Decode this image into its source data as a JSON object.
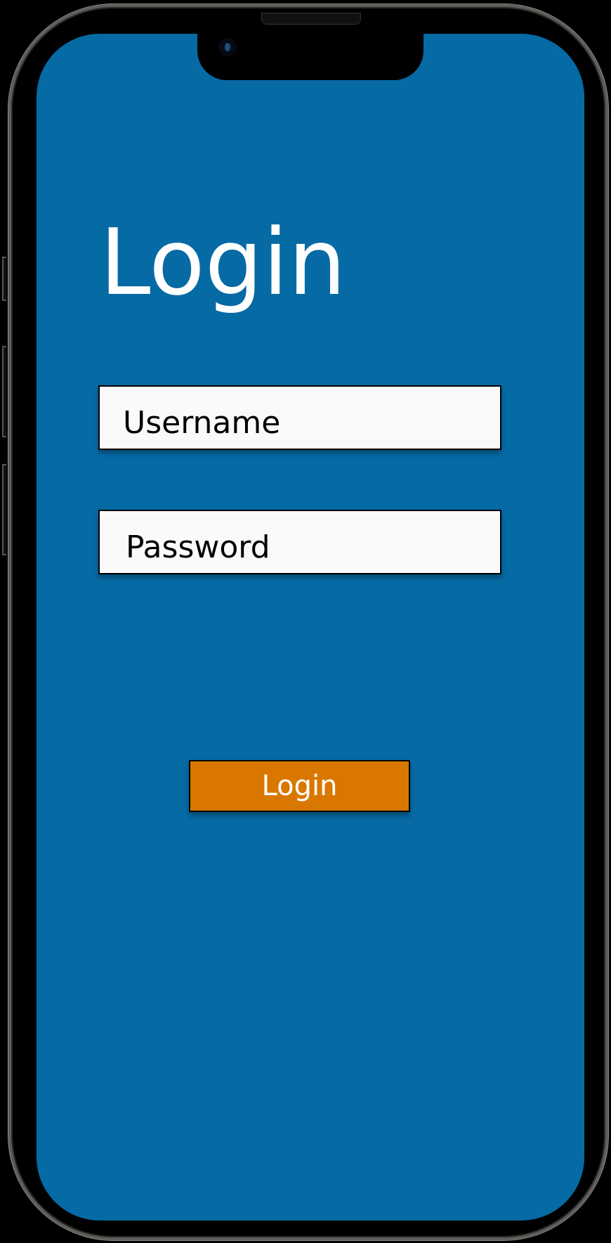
{
  "colors": {
    "background": "#066aa5",
    "button": "#d97700",
    "input": "#fafafa"
  },
  "login": {
    "title": "Login",
    "username_placeholder": "Username",
    "password_placeholder": "Password",
    "submit_label": "Login"
  }
}
